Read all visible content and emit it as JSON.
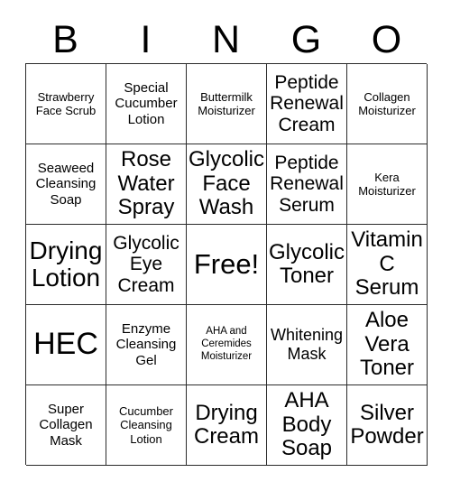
{
  "header": {
    "letters": [
      "B",
      "I",
      "N",
      "G",
      "O"
    ]
  },
  "grid": {
    "columns": 5,
    "rows": 5,
    "free_space_label": "Free!",
    "cells": [
      {
        "text": "Strawberry Face Scrub",
        "column": "B",
        "row": 1,
        "size": "sm",
        "free": false
      },
      {
        "text": "Special Cucumber Lotion",
        "column": "I",
        "row": 1,
        "size": "md",
        "free": false
      },
      {
        "text": "Buttermilk Moisturizer",
        "column": "N",
        "row": 1,
        "size": "sm",
        "free": false
      },
      {
        "text": "Peptide Renewal Cream",
        "column": "G",
        "row": 1,
        "size": "xl",
        "free": false
      },
      {
        "text": "Collagen Moisturizer",
        "column": "O",
        "row": 1,
        "size": "sm",
        "free": false
      },
      {
        "text": "Seaweed Cleansing Soap",
        "column": "B",
        "row": 2,
        "size": "md",
        "free": false
      },
      {
        "text": "Rose Water Spray",
        "column": "I",
        "row": 2,
        "size": "2xl",
        "free": false
      },
      {
        "text": "Glycolic Face Wash",
        "column": "N",
        "row": 2,
        "size": "2xl",
        "free": false
      },
      {
        "text": "Peptide Renewal Serum",
        "column": "G",
        "row": 2,
        "size": "xl",
        "free": false
      },
      {
        "text": "Kera Moisturizer",
        "column": "O",
        "row": 2,
        "size": "sm",
        "free": false
      },
      {
        "text": "Drying Lotion",
        "column": "B",
        "row": 3,
        "size": "3xl",
        "free": false
      },
      {
        "text": "Glycolic Eye Cream",
        "column": "I",
        "row": 3,
        "size": "xl",
        "free": false
      },
      {
        "text": "Free!",
        "column": "N",
        "row": 3,
        "size": "free",
        "free": true
      },
      {
        "text": "Glycolic Toner",
        "column": "G",
        "row": 3,
        "size": "2xl",
        "free": false
      },
      {
        "text": "Vitamin C Serum",
        "column": "O",
        "row": 3,
        "size": "2xl",
        "free": false
      },
      {
        "text": "HEC",
        "column": "B",
        "row": 4,
        "size": "hec",
        "free": false
      },
      {
        "text": "Enzyme Cleansing Gel",
        "column": "I",
        "row": 4,
        "size": "md",
        "free": false
      },
      {
        "text": "AHA and Ceremides Moisturizer",
        "column": "N",
        "row": 4,
        "size": "xs",
        "free": false
      },
      {
        "text": "Whitening Mask",
        "column": "G",
        "row": 4,
        "size": "lg",
        "free": false
      },
      {
        "text": "Aloe Vera Toner",
        "column": "O",
        "row": 4,
        "size": "2xl",
        "free": false
      },
      {
        "text": "Super Collagen Mask",
        "column": "B",
        "row": 5,
        "size": "md",
        "free": false
      },
      {
        "text": "Cucumber Cleansing Lotion",
        "column": "I",
        "row": 5,
        "size": "sm",
        "free": false
      },
      {
        "text": "Drying Cream",
        "column": "N",
        "row": 5,
        "size": "2xl",
        "free": false
      },
      {
        "text": "AHA Body Soap",
        "column": "G",
        "row": 5,
        "size": "2xl",
        "free": false
      },
      {
        "text": "Silver Powder",
        "column": "O",
        "row": 5,
        "size": "2xl",
        "free": false
      }
    ]
  },
  "style": {
    "background_color": "#ffffff",
    "text_color": "#000000",
    "border_color": "#2b2b2b"
  }
}
